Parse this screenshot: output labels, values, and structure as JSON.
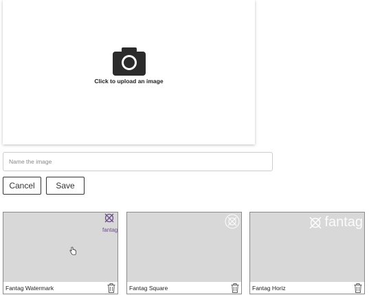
{
  "upload": {
    "label": "Click to upload an image",
    "icon": "camera-icon"
  },
  "name_field": {
    "value": "",
    "placeholder": "Name the image"
  },
  "buttons": {
    "cancel": "Cancel",
    "save": "Save"
  },
  "watermarks": [
    {
      "title": "Fantag Watermark",
      "logo_text": "fantag",
      "logo_color": "#6b4f8a"
    },
    {
      "title": "Fantag Square"
    },
    {
      "title": "Fantag Horiz",
      "logo_text": "fantag"
    }
  ],
  "colors": {
    "preview_bg": "#d8d8d8",
    "camera": "#2b2b2b",
    "border": "#8a8a8a"
  }
}
